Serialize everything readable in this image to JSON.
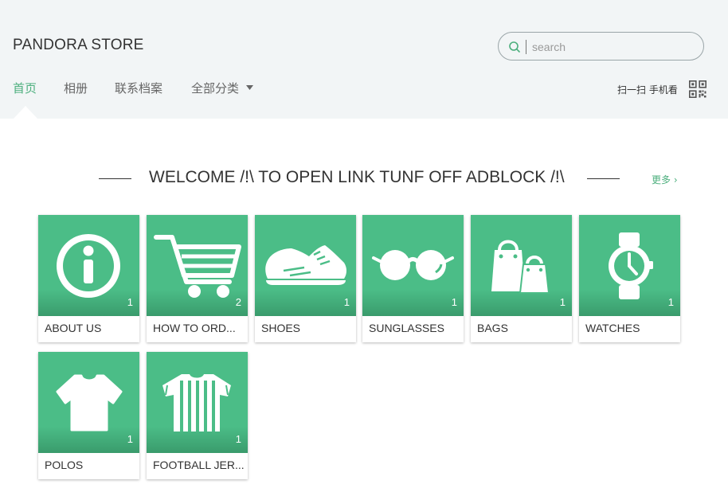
{
  "store": {
    "title": "PANDORA STORE"
  },
  "search": {
    "placeholder": "search"
  },
  "nav": {
    "items": [
      "首页",
      "相册",
      "联系档案",
      "全部分类"
    ]
  },
  "mobile": {
    "label": "扫一扫 手机看"
  },
  "section": {
    "title": "WELCOME /!\\ TO OPEN LINK TUNF OFF ADBLOCK /!\\",
    "more": "更多 ›"
  },
  "categories": [
    {
      "label": "ABOUT US",
      "count": "1",
      "icon": "info-icon"
    },
    {
      "label": "HOW TO ORD...",
      "count": "2",
      "icon": "cart-icon"
    },
    {
      "label": "SHOES",
      "count": "1",
      "icon": "shoe-icon"
    },
    {
      "label": "SUNGLASSES",
      "count": "1",
      "icon": "sunglasses-icon"
    },
    {
      "label": "BAGS",
      "count": "1",
      "icon": "bags-icon"
    },
    {
      "label": "WATCHES",
      "count": "1",
      "icon": "watch-icon"
    },
    {
      "label": "POLOS",
      "count": "1",
      "icon": "tshirt-icon"
    },
    {
      "label": "FOOTBALL JER...",
      "count": "1",
      "icon": "jersey-icon"
    }
  ],
  "colors": {
    "accent": "#4caf7d",
    "tile": "#4bbd87",
    "header_bg": "#f2f5f6"
  }
}
